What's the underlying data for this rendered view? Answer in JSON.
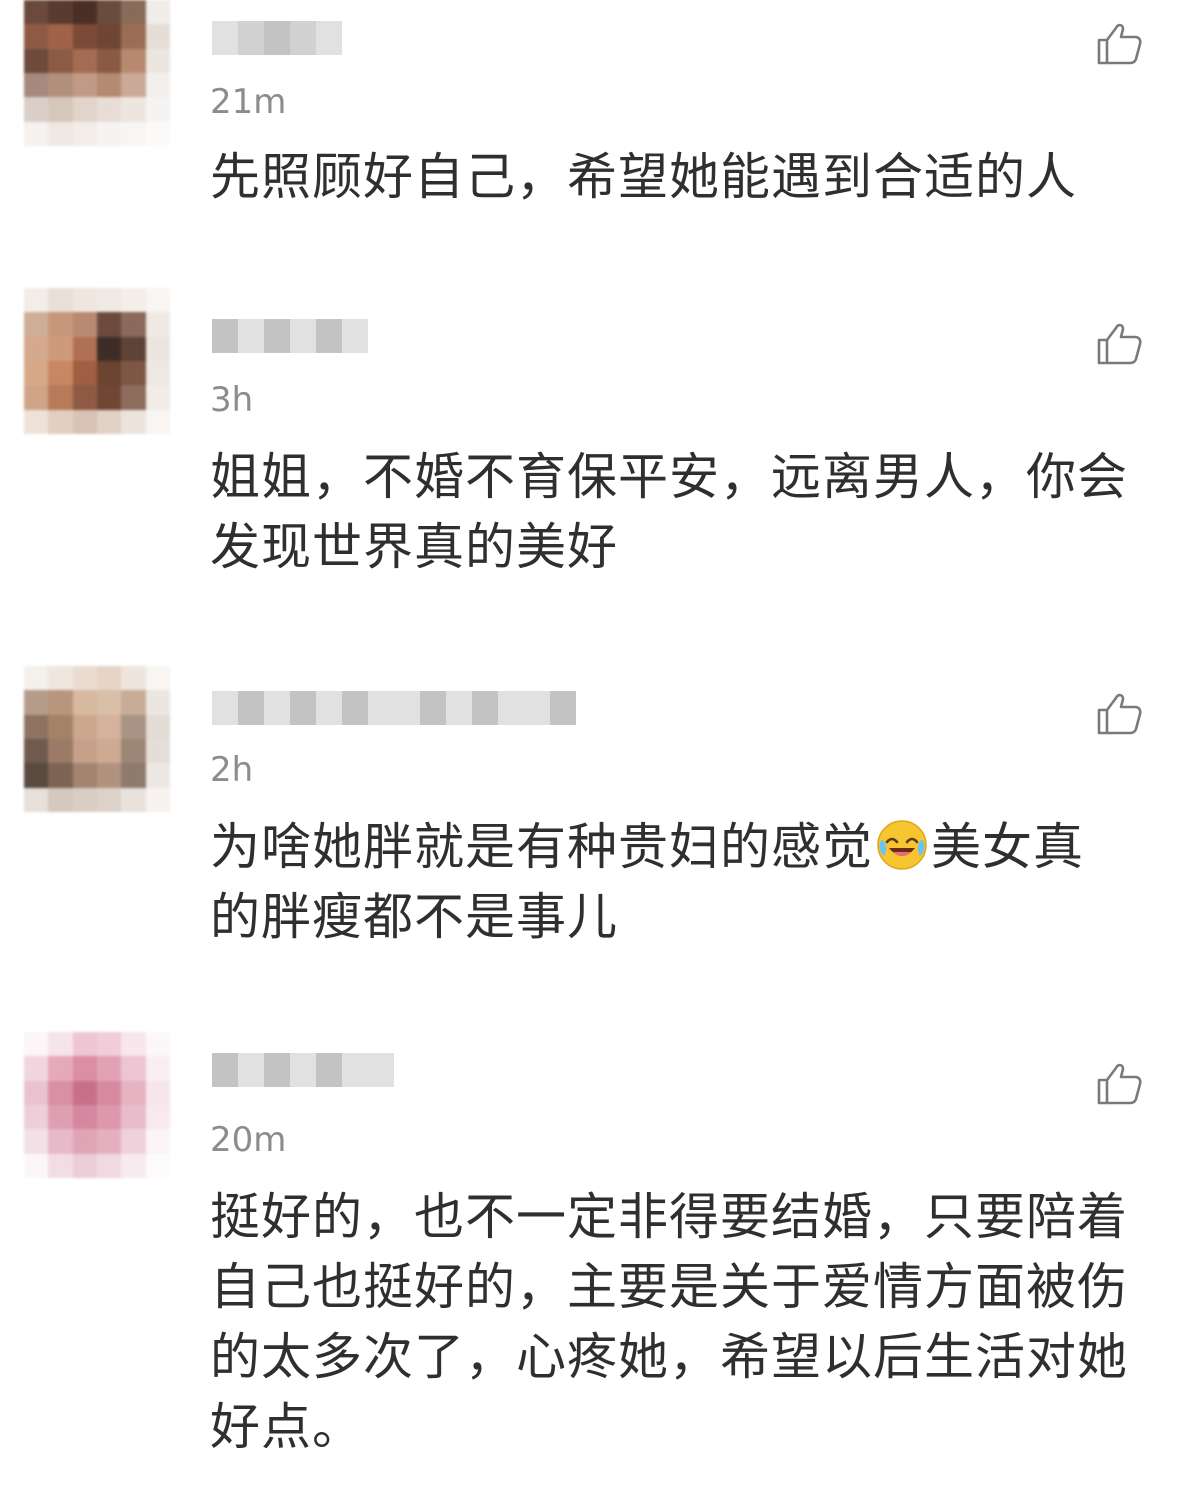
{
  "comments": [
    {
      "time": "21m",
      "text_parts": [
        "先照顾好自己，希望她能遇到合适的人"
      ],
      "avatar": [
        "#6b4a3c",
        "#5a3b2f",
        "#4a2f25",
        "#6a4c3e",
        "#8a6a58",
        "#f0ece8",
        "#8e5a44",
        "#a0634a",
        "#7c4a36",
        "#6f4634",
        "#9b6d55",
        "#e6ddd6",
        "#6e4a3c",
        "#8c5b45",
        "#a46c52",
        "#8a5a44",
        "#b78a70",
        "#ece6e0",
        "#a58a7d",
        "#b28f7c",
        "#c09a86",
        "#b48a72",
        "#caa996",
        "#f2efec",
        "#d9cfc8",
        "#d6c7bb",
        "#e2d4ca",
        "#e8ddd6",
        "#ede6e0",
        "#f6f4f2",
        "#f4f1ef",
        "#efe8e3",
        "#f2ede9",
        "#f6f3f1",
        "#f8f6f4",
        "#fbfaf9"
      ]
    },
    {
      "time": "3h",
      "text_parts": [
        "姐姐，不婚不育保平安，远离男人，你会",
        "发现世界真的美好"
      ],
      "avatar": [
        "#f3ede8",
        "#eadfd6",
        "#efe6df",
        "#f1e9e3",
        "#f4eee9",
        "#f8f5f2",
        "#cfae98",
        "#c7977c",
        "#b98a72",
        "#6c4b3e",
        "#8a6a5a",
        "#efe9e4",
        "#d4a98e",
        "#cf9a7b",
        "#b07055",
        "#3e2d27",
        "#5e4437",
        "#ece4de",
        "#d8a988",
        "#c88663",
        "#a05e42",
        "#6b4330",
        "#7d5645",
        "#efe7e1",
        "#cfa487",
        "#b77b5a",
        "#8e5a43",
        "#6f4734",
        "#8d6c5d",
        "#f2ece7",
        "#eee2d8",
        "#e2cfc1",
        "#d9c3b4",
        "#e1d1c6",
        "#ece3dc",
        "#f8f5f2"
      ]
    },
    {
      "time": "2h",
      "text_parts": [
        "为啥她胖就是有种贵妇的感觉",
        "美女真",
        "的胖瘦都不是事儿"
      ],
      "avatar": [
        "#f4f0ec",
        "#efe6de",
        "#e9dbd0",
        "#e6d4c6",
        "#efe5dd",
        "#f8f5f2",
        "#b59c8a",
        "#b8967d",
        "#d7b9a0",
        "#d9bfa7",
        "#c7ad98",
        "#ece6e1",
        "#8e7262",
        "#a48266",
        "#cda78c",
        "#d5b29c",
        "#a99384",
        "#e3dcd6",
        "#6f5a4d",
        "#9c7b66",
        "#c7a08a",
        "#cfaa92",
        "#9c8676",
        "#e5ded8",
        "#5a4a40",
        "#7d6453",
        "#a28470",
        "#b1927f",
        "#8f7b6e",
        "#ece7e2",
        "#e6dfda",
        "#d4c8bf",
        "#d9cdc4",
        "#ddd2ca",
        "#e8e1dc",
        "#f6f3f1"
      ]
    },
    {
      "time": "20m",
      "text_parts": [
        "挺好的，也不一定非得要结婚，只要陪着",
        "自己也挺好的，主要是关于爱情方面被伤",
        "的太多次了，心疼她，希望以后生活对她",
        "好点。"
      ],
      "avatar": [
        "#fbf6f8",
        "#f5e4ea",
        "#eec6d3",
        "#f0cdd8",
        "#f7e6ec",
        "#fcf8f9",
        "#f1d6df",
        "#e6a9bc",
        "#dc8ea6",
        "#e2a2b5",
        "#eec5d2",
        "#f9eef2",
        "#eac2cf",
        "#d98fa5",
        "#c86f8c",
        "#d68aa1",
        "#e7b3c3",
        "#f6e6ec",
        "#edcfd9",
        "#df9fb3",
        "#d587a0",
        "#dc98ad",
        "#e9bccb",
        "#f7e9ee",
        "#f3e1e7",
        "#e8b9c8",
        "#dfa5b7",
        "#e4b0c0",
        "#efd1db",
        "#fbf4f6",
        "#fbf7f8",
        "#f3dde5",
        "#eccdd7",
        "#f1d9e1",
        "#f7ebef",
        "#fdfafb"
      ]
    }
  ],
  "icons": {
    "like": "thumbs-up-icon",
    "emoji": "laughing-crying-face-icon"
  }
}
